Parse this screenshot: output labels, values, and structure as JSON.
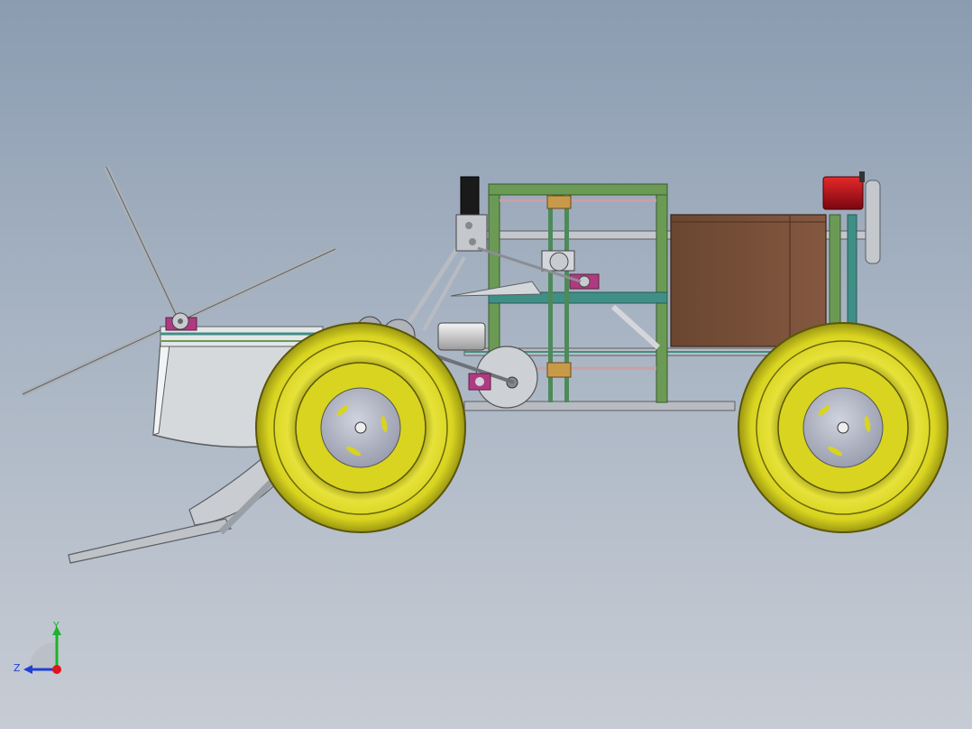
{
  "viewport": {
    "background_top": "#8b9cb1",
    "background_bottom": "#c7ccd4",
    "model": "vehicle-assembly-side-view"
  },
  "triad": {
    "y_label": "Y",
    "z_label": "Z",
    "y_color": "#1db32a",
    "z_color": "#1f3fd6",
    "x_color": "#e0141e"
  },
  "colors": {
    "tire": "#d8d420",
    "tire_dark": "#8e8a10",
    "hub": "#b4b8c8",
    "frame_green": "#6b9a55",
    "frame_teal": "#3f8f86",
    "steel": "#b8bcc2",
    "bin_brown": "#7a5038",
    "motor_red": "#c81020",
    "bearing_magenta": "#b03a82",
    "motor_black": "#1a1a1a"
  }
}
